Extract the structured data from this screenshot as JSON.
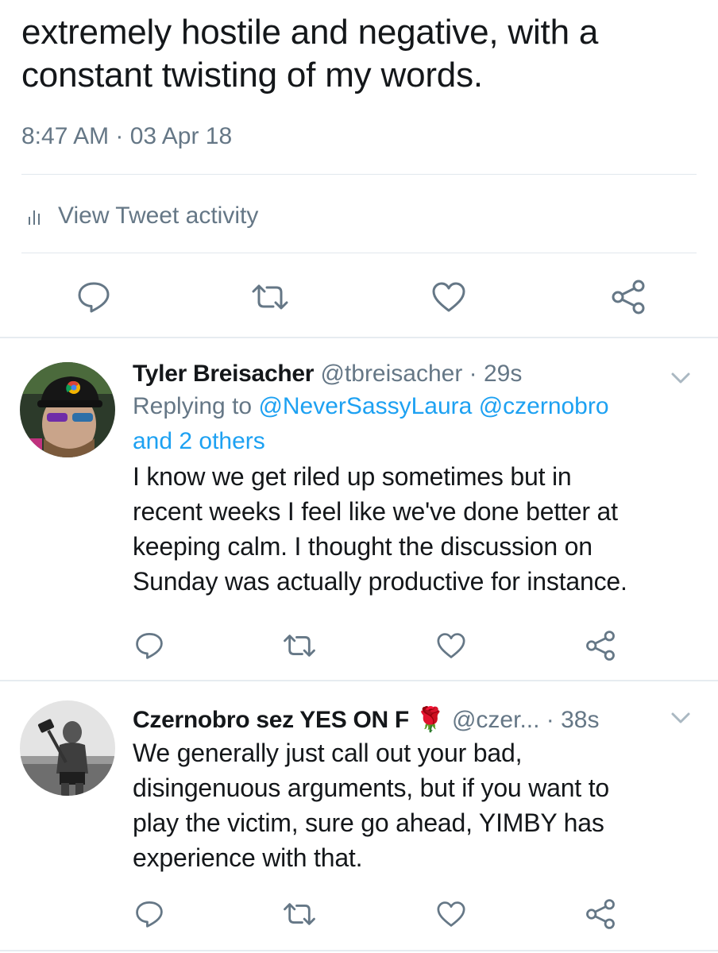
{
  "main_tweet": {
    "text_line1": "extremely hostile and negative, with a",
    "text_line2": "constant twisting of my words.",
    "timestamp": "8:47 AM · 03 Apr 18",
    "activity_label": "View Tweet activity",
    "actions": [
      "reply-icon",
      "retweet-icon",
      "like-icon",
      "share-icon"
    ]
  },
  "replies": [
    {
      "name": "Tyler Breisacher",
      "handle": "@tbreisacher",
      "separator": " · ",
      "age": "29s",
      "replying_prefix": "Replying to ",
      "mention1": "@NeverSassyLaura",
      "mention2": "@czernobro",
      "mention3": "and 2 others",
      "text_lines": [
        "I know we get riled up sometimes but in",
        "recent weeks I feel like we've done better at",
        "keeping calm. I thought the discussion on",
        "Sunday was actually productive for instance."
      ]
    },
    {
      "name": "Czernobro sez YES ON F",
      "emoji": "🌹",
      "handle": "@czer...",
      "separator": " · ",
      "age": "38s",
      "text_lines": [
        "We generally just call out your bad,",
        "disingenuous arguments, but if you want to",
        "play the victim, sure go ahead, YIMBY has",
        "experience with that."
      ]
    }
  ],
  "colors": {
    "text": "#14171a",
    "secondary": "#657786",
    "link": "#1da1f2",
    "divider": "#e1e8ed",
    "rose": "#c4122f"
  }
}
